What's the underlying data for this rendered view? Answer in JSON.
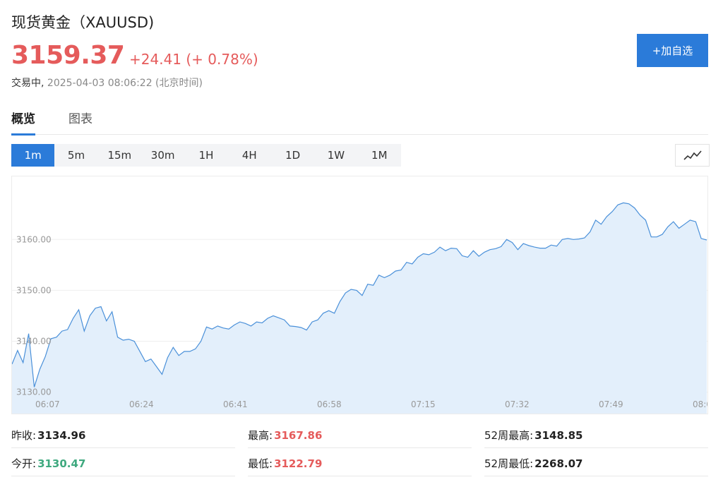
{
  "header": {
    "title": "现货黄金（XAUUSD)",
    "price": "3159.37",
    "change": "+24.41 (+ 0.78%)",
    "status": "交易中,",
    "timestamp": "2025-04-03 08:06:22 (北京时间)",
    "watch_button": "+加自选"
  },
  "tabs": [
    {
      "label": "概览",
      "active": true
    },
    {
      "label": "图表",
      "active": false
    }
  ],
  "periods": [
    "1m",
    "5m",
    "15m",
    "30m",
    "1H",
    "4H",
    "1D",
    "1W",
    "1M"
  ],
  "active_period": "1m",
  "chart_type_icon": "line-chart-icon",
  "chart_data": {
    "type": "area",
    "x_ticks": [
      "06:07",
      "06:24",
      "06:41",
      "06:58",
      "07:15",
      "07:32",
      "07:49",
      "08:0"
    ],
    "y_ticks": [
      "3130.00",
      "3140.00",
      "3150.00",
      "3160.00"
    ],
    "ylim": [
      3128,
      3171
    ],
    "line_color": "#4a90d9",
    "fill_color": "#e3effb",
    "values": [
      3135.5,
      3138.2,
      3135.8,
      3141.5,
      3131.0,
      3134.5,
      3137.0,
      3140.5,
      3140.8,
      3142.0,
      3142.3,
      3144.5,
      3146.2,
      3142.0,
      3145.0,
      3146.5,
      3146.8,
      3144.0,
      3145.8,
      3140.8,
      3140.2,
      3140.4,
      3140.0,
      3138.0,
      3136.0,
      3136.5,
      3135.0,
      3133.5,
      3136.8,
      3138.8,
      3137.2,
      3138.0,
      3138.0,
      3138.5,
      3140.0,
      3142.8,
      3142.4,
      3143.0,
      3142.6,
      3142.4,
      3143.2,
      3143.8,
      3143.5,
      3143.0,
      3143.8,
      3143.6,
      3144.5,
      3145.0,
      3144.6,
      3144.2,
      3143.0,
      3142.9,
      3142.7,
      3142.2,
      3143.8,
      3144.2,
      3145.5,
      3146.0,
      3145.5,
      3147.8,
      3149.5,
      3150.2,
      3150.0,
      3149.0,
      3151.2,
      3151.0,
      3153.0,
      3152.5,
      3153.0,
      3153.8,
      3154.0,
      3155.5,
      3155.2,
      3156.5,
      3157.2,
      3157.0,
      3157.5,
      3158.5,
      3157.8,
      3158.3,
      3158.2,
      3156.8,
      3156.5,
      3157.8,
      3156.7,
      3157.5,
      3158.0,
      3158.2,
      3158.6,
      3160.0,
      3159.4,
      3158.0,
      3159.2,
      3158.8,
      3158.5,
      3158.3,
      3158.3,
      3158.9,
      3158.7,
      3160.0,
      3160.2,
      3160.0,
      3160.1,
      3160.3,
      3161.5,
      3163.8,
      3163.0,
      3164.5,
      3165.5,
      3166.8,
      3167.2,
      3167.0,
      3166.2,
      3164.8,
      3163.8,
      3160.5,
      3160.5,
      3161.0,
      3162.5,
      3163.5,
      3162.2,
      3163.0,
      3163.8,
      3163.5,
      3160.2,
      3159.9
    ]
  },
  "stats": [
    {
      "label": "昨收:",
      "value": "3134.96",
      "color": "normal"
    },
    {
      "label": "最高:",
      "value": "3167.86",
      "color": "red"
    },
    {
      "label": "52周最高:",
      "value": "3148.85",
      "color": "normal"
    },
    {
      "label": "今开:",
      "value": "3130.47",
      "color": "green"
    },
    {
      "label": "最低:",
      "value": "3122.79",
      "color": "red"
    },
    {
      "label": "52周最低:",
      "value": "2268.07",
      "color": "normal"
    }
  ]
}
